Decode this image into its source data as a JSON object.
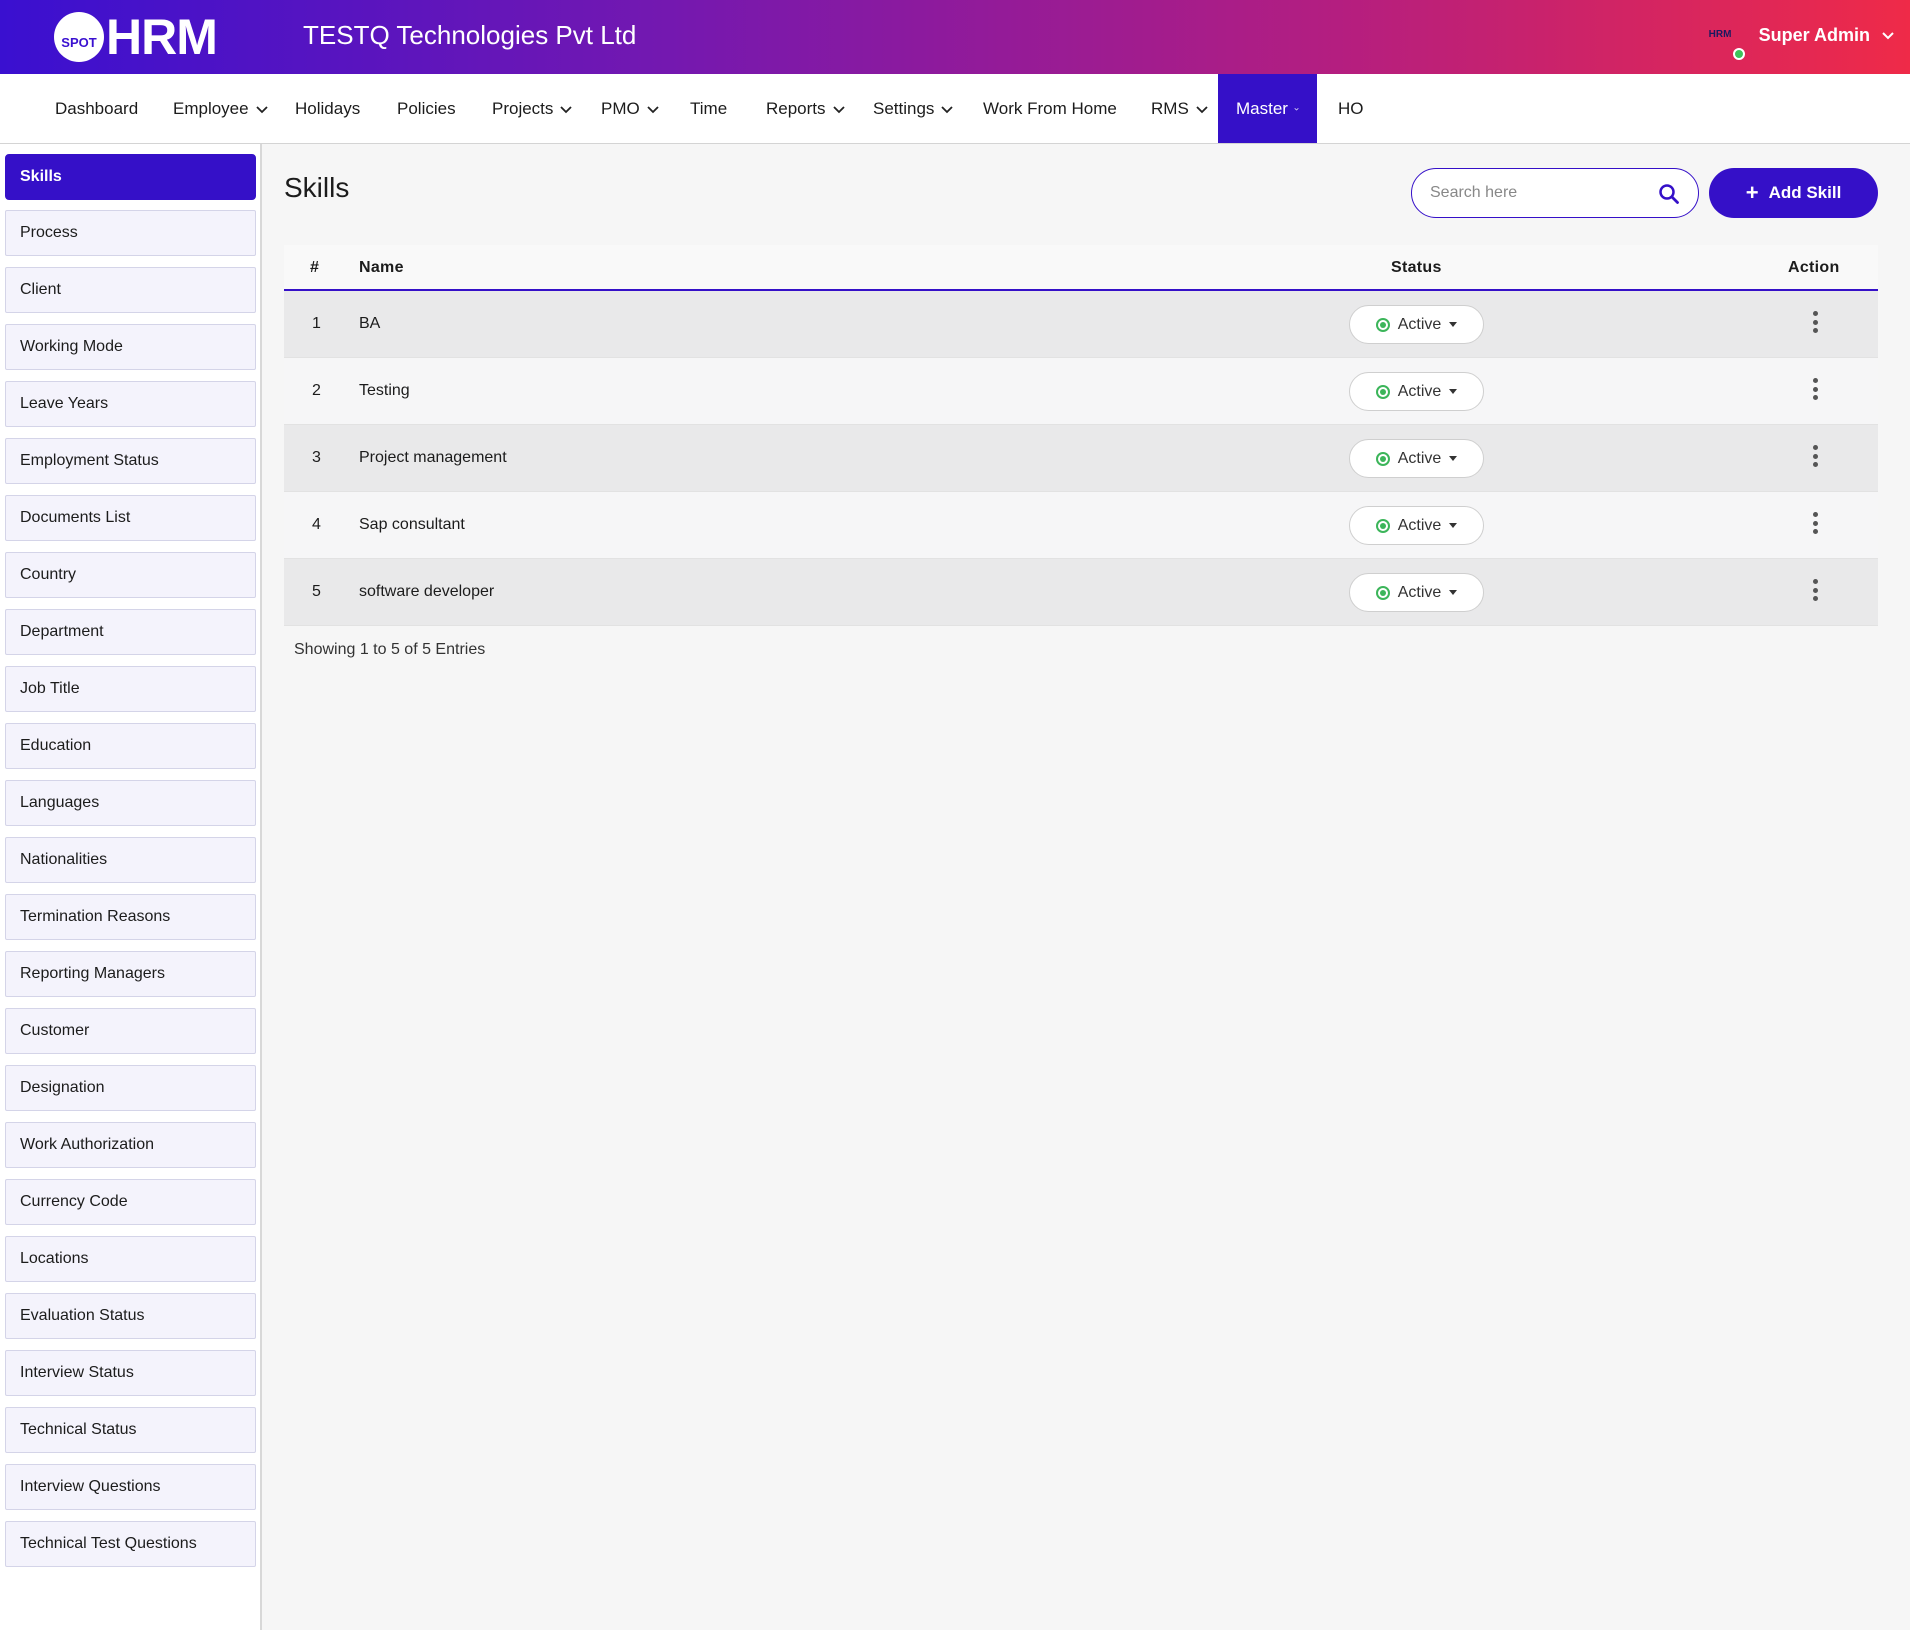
{
  "header": {
    "logo_badge": "SPOT",
    "logo_text": "HRM",
    "company": "TESTQ Technologies Pvt Ltd",
    "user_avatar_text": "HRM",
    "user_name": "Super Admin",
    "user_status_color": "#3cc45a"
  },
  "nav": [
    {
      "label": "Dashboard",
      "dropdown": false
    },
    {
      "label": "Employee",
      "dropdown": true
    },
    {
      "label": "Holidays",
      "dropdown": false
    },
    {
      "label": "Policies",
      "dropdown": false
    },
    {
      "label": "Projects",
      "dropdown": true
    },
    {
      "label": "PMO",
      "dropdown": true
    },
    {
      "label": "Time",
      "dropdown": false
    },
    {
      "label": "Reports",
      "dropdown": true
    },
    {
      "label": "Settings",
      "dropdown": true
    },
    {
      "label": "Work From Home",
      "dropdown": false
    },
    {
      "label": "RMS",
      "dropdown": true
    },
    {
      "label": "Master",
      "dropdown": true,
      "active": true
    },
    {
      "label": "HO",
      "dropdown": false
    }
  ],
  "sidebar": {
    "items": [
      {
        "label": "Skills",
        "active": true
      },
      {
        "label": "Process"
      },
      {
        "label": "Client"
      },
      {
        "label": "Working Mode"
      },
      {
        "label": "Leave Years"
      },
      {
        "label": "Employment Status"
      },
      {
        "label": "Documents List"
      },
      {
        "label": "Country"
      },
      {
        "label": "Department"
      },
      {
        "label": "Job Title"
      },
      {
        "label": "Education"
      },
      {
        "label": "Languages"
      },
      {
        "label": "Nationalities"
      },
      {
        "label": "Termination Reasons"
      },
      {
        "label": "Reporting Managers"
      },
      {
        "label": "Customer"
      },
      {
        "label": "Designation"
      },
      {
        "label": "Work Authorization"
      },
      {
        "label": "Currency Code"
      },
      {
        "label": "Locations"
      },
      {
        "label": "Evaluation Status"
      },
      {
        "label": "Interview Status"
      },
      {
        "label": "Technical Status"
      },
      {
        "label": "Interview Questions"
      },
      {
        "label": "Technical Test Questions"
      }
    ]
  },
  "main": {
    "title": "Skills",
    "search_placeholder": "Search here",
    "add_button": "Add Skill",
    "columns": {
      "index": "#",
      "name": "Name",
      "status": "Status",
      "action": "Action"
    },
    "rows": [
      {
        "index": "1",
        "name": "BA",
        "status": "Active"
      },
      {
        "index": "2",
        "name": "Testing",
        "status": "Active"
      },
      {
        "index": "3",
        "name": "Project management",
        "status": "Active"
      },
      {
        "index": "4",
        "name": "Sap consultant",
        "status": "Active"
      },
      {
        "index": "5",
        "name": "software developer",
        "status": "Active"
      }
    ],
    "footer": "Showing 1 to 5 of 5 Entries"
  },
  "colors": {
    "accent": "#3510c8",
    "status_active": "#3cb55a",
    "header_gradient": [
      "#3a10d0",
      "#7418b0",
      "#b41e80",
      "#ef2a48"
    ]
  }
}
